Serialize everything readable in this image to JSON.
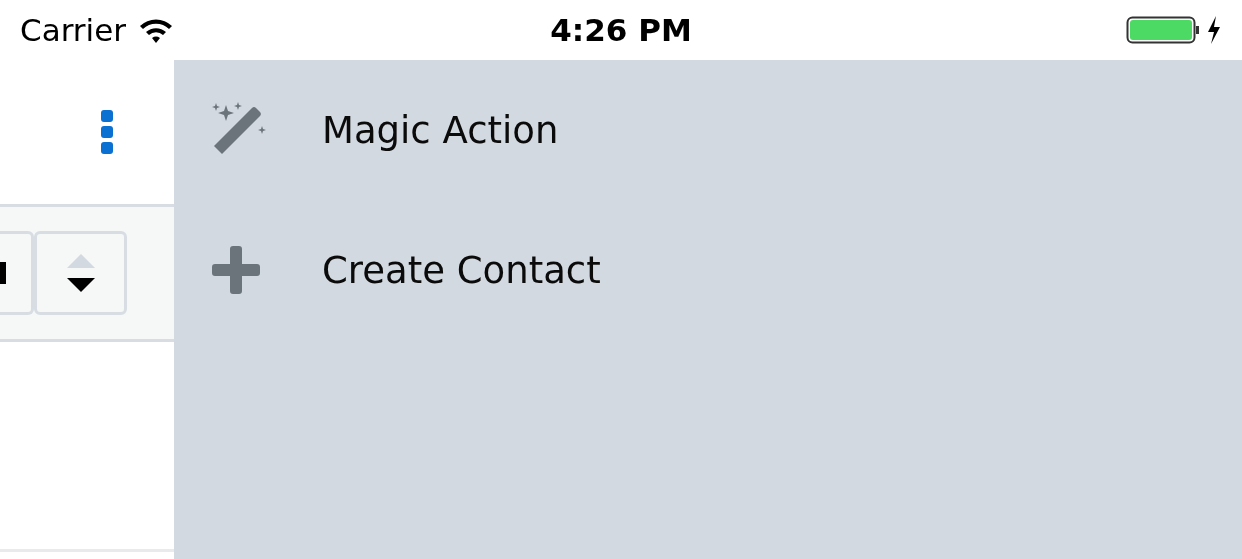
{
  "status_bar": {
    "carrier": "Carrier",
    "time": "4:26 PM"
  },
  "menu": {
    "items": [
      {
        "kind": "wand",
        "label": "Magic Action"
      },
      {
        "kind": "plus",
        "label": "Create Contact"
      }
    ]
  }
}
